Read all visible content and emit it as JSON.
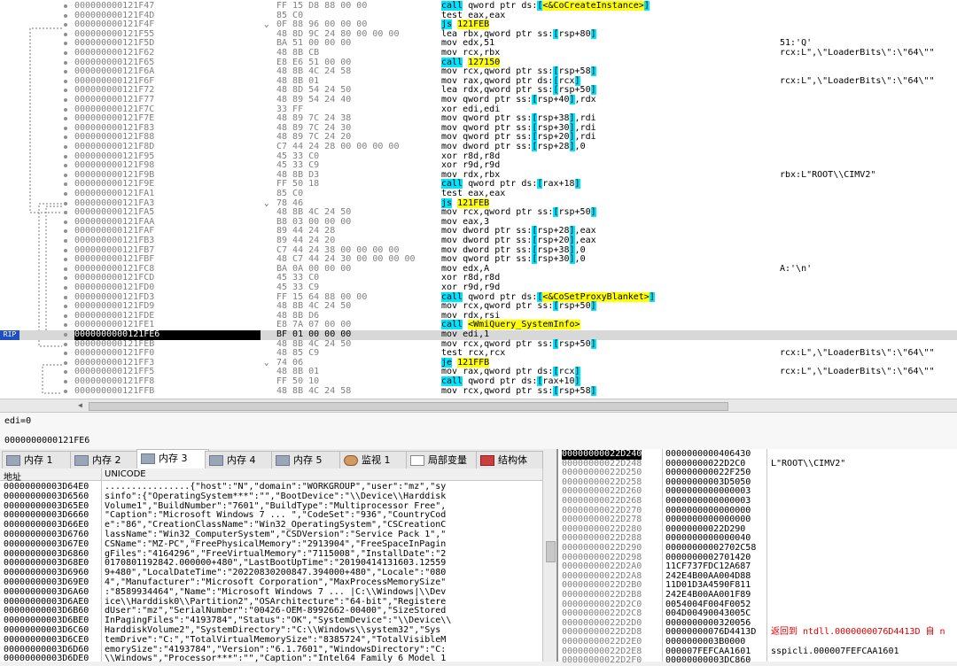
{
  "disasm": {
    "rows": [
      {
        "addr": "000000000121F47",
        "bytes": "FF 15 D8 88 00 00",
        "instr": "call qword ptr ds:[<&CoCreateInstance>]",
        "comment": ""
      },
      {
        "addr": "000000000121F4D",
        "bytes": "85 C0",
        "instr": "test eax,eax",
        "comment": ""
      },
      {
        "addr": "000000000121F4F",
        "bytes": "0F 88 96 00 00 00",
        "instr": "js 121FEB",
        "comment": ""
      },
      {
        "addr": "000000000121F55",
        "bytes": "48 8D 9C 24 80 00 00 00",
        "instr": "lea rbx,qword ptr ss:[rsp+80]",
        "comment": ""
      },
      {
        "addr": "000000000121F5D",
        "bytes": "BA 51 00 00 00",
        "instr": "mov edx,51",
        "comment": "51:'Q'"
      },
      {
        "addr": "000000000121F62",
        "bytes": "48 8B CB",
        "instr": "mov rcx,rbx",
        "comment": "rcx:L\",\\\"LoaderBits\\\":\\\"64\\\"\""
      },
      {
        "addr": "000000000121F65",
        "bytes": "E8 E6 51 00 00",
        "instr": "call 127150",
        "comment": ""
      },
      {
        "addr": "000000000121F6A",
        "bytes": "48 8B 4C 24 58",
        "instr": "mov rcx,qword ptr ss:[rsp+58]",
        "comment": ""
      },
      {
        "addr": "000000000121F6F",
        "bytes": "48 8B 01",
        "instr": "mov rax,qword ptr ds:[rcx]",
        "comment": "rcx:L\",\\\"LoaderBits\\\":\\\"64\\\"\""
      },
      {
        "addr": "000000000121F72",
        "bytes": "48 8D 54 24 50",
        "instr": "lea rdx,qword ptr ss:[rsp+50]",
        "comment": ""
      },
      {
        "addr": "000000000121F77",
        "bytes": "48 89 54 24 40",
        "instr": "mov qword ptr ss:[rsp+40],rdx",
        "comment": ""
      },
      {
        "addr": "000000000121F7C",
        "bytes": "33 FF",
        "instr": "xor edi,edi",
        "comment": ""
      },
      {
        "addr": "000000000121F7E",
        "bytes": "48 89 7C 24 38",
        "instr": "mov qword ptr ss:[rsp+38],rdi",
        "comment": ""
      },
      {
        "addr": "000000000121F83",
        "bytes": "48 89 7C 24 30",
        "instr": "mov qword ptr ss:[rsp+30],rdi",
        "comment": ""
      },
      {
        "addr": "000000000121F88",
        "bytes": "48 89 7C 24 20",
        "instr": "mov qword ptr ss:[rsp+20],rdi",
        "comment": ""
      },
      {
        "addr": "000000000121F8D",
        "bytes": "C7 44 24 28 00 00 00 00",
        "instr": "mov dword ptr ss:[rsp+28],0",
        "comment": ""
      },
      {
        "addr": "000000000121F95",
        "bytes": "45 33 C0",
        "instr": "xor r8d,r8d",
        "comment": ""
      },
      {
        "addr": "000000000121F98",
        "bytes": "45 33 C9",
        "instr": "xor r9d,r9d",
        "comment": ""
      },
      {
        "addr": "000000000121F9B",
        "bytes": "48 8B D3",
        "instr": "mov rdx,rbx",
        "comment": "rbx:L\"ROOT\\\\CIMV2\""
      },
      {
        "addr": "000000000121F9E",
        "bytes": "FF 50 18",
        "instr": "call qword ptr ds:[rax+18]",
        "comment": ""
      },
      {
        "addr": "000000000121FA1",
        "bytes": "85 C0",
        "instr": "test eax,eax",
        "comment": ""
      },
      {
        "addr": "000000000121FA3",
        "bytes": "78 46",
        "instr": "js 121FEB",
        "comment": ""
      },
      {
        "addr": "000000000121FA5",
        "bytes": "48 8B 4C 24 50",
        "instr": "mov rcx,qword ptr ss:[rsp+50]",
        "comment": ""
      },
      {
        "addr": "000000000121FAA",
        "bytes": "B8 03 00 00 00",
        "instr": "mov eax,3",
        "comment": ""
      },
      {
        "addr": "000000000121FAF",
        "bytes": "89 44 24 28",
        "instr": "mov dword ptr ss:[rsp+28],eax",
        "comment": ""
      },
      {
        "addr": "000000000121FB3",
        "bytes": "89 44 24 20",
        "instr": "mov dword ptr ss:[rsp+20],eax",
        "comment": ""
      },
      {
        "addr": "000000000121FB7",
        "bytes": "C7 44 24 38 00 00 00 00",
        "instr": "mov dword ptr ss:[rsp+38],0",
        "comment": ""
      },
      {
        "addr": "000000000121FBF",
        "bytes": "48 C7 44 24 30 00 00 00 00",
        "instr": "mov qword ptr ss:[rsp+30],0",
        "comment": ""
      },
      {
        "addr": "000000000121FC8",
        "bytes": "BA 0A 00 00 00",
        "instr": "mov edx,A",
        "comment": "A:'\\n'"
      },
      {
        "addr": "000000000121FCD",
        "bytes": "45 33 C0",
        "instr": "xor r8d,r8d",
        "comment": ""
      },
      {
        "addr": "000000000121FD0",
        "bytes": "45 33 C9",
        "instr": "xor r9d,r9d",
        "comment": ""
      },
      {
        "addr": "000000000121FD3",
        "bytes": "FF 15 64 88 00 00",
        "instr": "call qword ptr ds:[<&CoSetProxyBlanket>]",
        "comment": ""
      },
      {
        "addr": "000000000121FD9",
        "bytes": "48 8B 4C 24 50",
        "instr": "mov rcx,qword ptr ss:[rsp+50]",
        "comment": ""
      },
      {
        "addr": "000000000121FDE",
        "bytes": "48 8B D6",
        "instr": "mov rdx,rsi",
        "comment": ""
      },
      {
        "addr": "000000000121FE1",
        "bytes": "E8 7A 07 00 00",
        "instr": "call <WmiQuery_SystemInfo>",
        "comment": ""
      },
      {
        "addr": "0000000000121FE6",
        "bytes": "BF 01 00 00 00",
        "instr": "mov edi,1",
        "comment": ""
      },
      {
        "addr": "000000000121FEB",
        "bytes": "48 8B 4C 24 50",
        "instr": "mov rcx,qword ptr ss:[rsp+50]",
        "comment": ""
      },
      {
        "addr": "000000000121FF0",
        "bytes": "48 85 C9",
        "instr": "test rcx,rcx",
        "comment": "rcx:L\",\\\"LoaderBits\\\":\\\"64\\\"\""
      },
      {
        "addr": "000000000121FF3",
        "bytes": "74 06",
        "instr": "je 121FFB",
        "comment": ""
      },
      {
        "addr": "000000000121FF5",
        "bytes": "48 8B 01",
        "instr": "mov rax,qword ptr ds:[rcx]",
        "comment": "rcx:L\",\\\"LoaderBits\\\":\\\"64\\\"\""
      },
      {
        "addr": "000000000121FF8",
        "bytes": "FF 50 10",
        "instr": "call qword ptr ds:[rax+10]",
        "comment": ""
      },
      {
        "addr": "000000000121FFB",
        "bytes": "48 8B 4C 24 58",
        "instr": "mov rcx,qword ptr ss:[rsp+58]",
        "comment": ""
      }
    ],
    "rip_label": "RIP",
    "current_index": 35
  },
  "info": {
    "line1": "edi=0",
    "line2": "0000000000121FE6"
  },
  "tabs": [
    {
      "label": "内存 1",
      "icon": "memory-icon"
    },
    {
      "label": "内存 2",
      "icon": "memory-icon"
    },
    {
      "label": "内存 3",
      "icon": "memory-icon"
    },
    {
      "label": "内存 4",
      "icon": "memory-icon"
    },
    {
      "label": "内存 5",
      "icon": "memory-icon"
    },
    {
      "label": "监视 1",
      "icon": "watch-icon"
    },
    {
      "label": "局部变量",
      "icon": "locals-icon"
    },
    {
      "label": "结构体",
      "icon": "struct-icon"
    }
  ],
  "active_tab": 2,
  "dump": {
    "col_addr": "地址",
    "col_text": "UNICODE",
    "rows": [
      {
        "addr": "00000000003D64E0",
        "text": "................{\"host\":\"N\",\"domain\":\"WORKGROUP\",\"user\":\"mz\",\"sy"
      },
      {
        "addr": "00000000003D6560",
        "text": "sinfo\":{\"OperatingSystem***\":\"\",\"BootDevice\":\"\\\\Device\\\\Harddisk"
      },
      {
        "addr": "00000000003D65E0",
        "text": "Volume1\",\"BuildNumber\":\"7601\",\"BuildType\":\"Multiprocessor Free\","
      },
      {
        "addr": "00000000003D6660",
        "text": "\"Caption\":\"Microsoft Windows 7 ... \",\"CodeSet\":\"936\",\"CountryCod"
      },
      {
        "addr": "00000000003D66E0",
        "text": "e\":\"86\",\"CreationClassName\":\"Win32_OperatingSystem\",\"CSCreationC"
      },
      {
        "addr": "00000000003D6760",
        "text": "lassName\":\"Win32_ComputerSystem\",\"CSDVersion\":\"Service Pack 1\",\""
      },
      {
        "addr": "00000000003D67E0",
        "text": "CSName\":\"MZ-PC\",\"FreePhysicalMemory\":\"2913904\",\"FreeSpaceInPagin"
      },
      {
        "addr": "00000000003D6860",
        "text": "gFiles\":\"4164296\",\"FreeVirtualMemory\":\"7115008\",\"InstallDate\":\"2"
      },
      {
        "addr": "00000000003D68E0",
        "text": "0170801192842.000000+480\",\"LastBootUpTime\":\"20190414131603.12559"
      },
      {
        "addr": "00000000003D6960",
        "text": "9+480\",\"LocalDateTime\":\"20220830200847.394000+480\",\"Locale\":\"080"
      },
      {
        "addr": "00000000003D69E0",
        "text": "4\",\"Manufacturer\":\"Microsoft Corporation\",\"MaxProcessMemorySize\""
      },
      {
        "addr": "00000000003D6A60",
        "text": ":\"8589934464\",\"Name\":\"Microsoft Windows 7 ... |C:\\\\Windows|\\\\Dev"
      },
      {
        "addr": "00000000003D6AE0",
        "text": "ice\\\\Harddisk0\\\\Partition2\",\"OSArchitecture\":\"64-bit\",\"Registere"
      },
      {
        "addr": "00000000003D6B60",
        "text": "dUser\":\"mz\",\"SerialNumber\":\"00426-OEM-8992662-00400\",\"SizeStored"
      },
      {
        "addr": "00000000003D6BE0",
        "text": "InPagingFiles\":\"4193784\",\"Status\":\"OK\",\"SystemDevice\":\"\\\\Device\\\\"
      },
      {
        "addr": "00000000003D6C60",
        "text": "HarddiskVolume2\",\"SystemDirectory\":\"C:\\\\Windows\\\\system32\",\"Sys"
      },
      {
        "addr": "00000000003D6CE0",
        "text": "temDrive\":\"C:\",\"TotalVirtualMemorySize\":\"8385724\",\"TotalVisibleM"
      },
      {
        "addr": "00000000003D6D60",
        "text": "emorySize\":\"4193784\",\"Version\":\"6.1.7601\",\"WindowsDirectory\":\"C:"
      },
      {
        "addr": "00000000003D6DE0",
        "text": "\\\\Windows\",\"Processor***\":\"\",\"Caption\":\"Intel64 Family 6 Model 1"
      }
    ]
  },
  "stack": {
    "rows": [
      {
        "addr": "00000000022D240",
        "val": "0000000000406430",
        "cmt": ""
      },
      {
        "addr": "00000000022D248",
        "val": "00000000022D2C0",
        "cmt": "L\"ROOT\\\\CIMV2\""
      },
      {
        "addr": "00000000022D250",
        "val": "000000000022F250",
        "cmt": ""
      },
      {
        "addr": "00000000022D258",
        "val": "00000000003D5050",
        "cmt": ""
      },
      {
        "addr": "00000000022D260",
        "val": "0000000000000003",
        "cmt": ""
      },
      {
        "addr": "00000000022D268",
        "val": "0000000000000003",
        "cmt": ""
      },
      {
        "addr": "00000000022D270",
        "val": "0000000000000000",
        "cmt": ""
      },
      {
        "addr": "00000000022D278",
        "val": "0000000000000000",
        "cmt": ""
      },
      {
        "addr": "00000000022D280",
        "val": "00000000022D290",
        "cmt": ""
      },
      {
        "addr": "00000000022D288",
        "val": "0000000000000040",
        "cmt": ""
      },
      {
        "addr": "00000000022D290",
        "val": "00000000002702C58",
        "cmt": ""
      },
      {
        "addr": "00000000022D298",
        "val": "0000000002701420",
        "cmt": ""
      },
      {
        "addr": "00000000022D2A0",
        "val": "11CF737FDC12A687",
        "cmt": ""
      },
      {
        "addr": "00000000022D2A8",
        "val": "242E4B00AA004D88",
        "cmt": ""
      },
      {
        "addr": "00000000022D2B0",
        "val": "11D01D3A4590F811",
        "cmt": ""
      },
      {
        "addr": "00000000022D2B8",
        "val": "242E4B00AA001F89",
        "cmt": ""
      },
      {
        "addr": "00000000022D2C0",
        "val": "0054004F004F0052",
        "cmt": ""
      },
      {
        "addr": "00000000022D2C8",
        "val": "004D00490043005C",
        "cmt": ""
      },
      {
        "addr": "00000000022D2D0",
        "val": "0000000000320056",
        "cmt": ""
      },
      {
        "addr": "00000000022D2D8",
        "val": "00000000076D4413D",
        "cmt": "返回到 ntdll.0000000076D4413D 自 n"
      },
      {
        "addr": "00000000022D2E0",
        "val": "0000000003B0000",
        "cmt": ""
      },
      {
        "addr": "00000000022D2E8",
        "val": "000007FEFCAA1601",
        "cmt": "sspicli.000007FEFCAA1601"
      },
      {
        "addr": "00000000022D2F0",
        "val": "00000000003DC860",
        "cmt": ""
      }
    ],
    "red_comment_index": 19
  }
}
